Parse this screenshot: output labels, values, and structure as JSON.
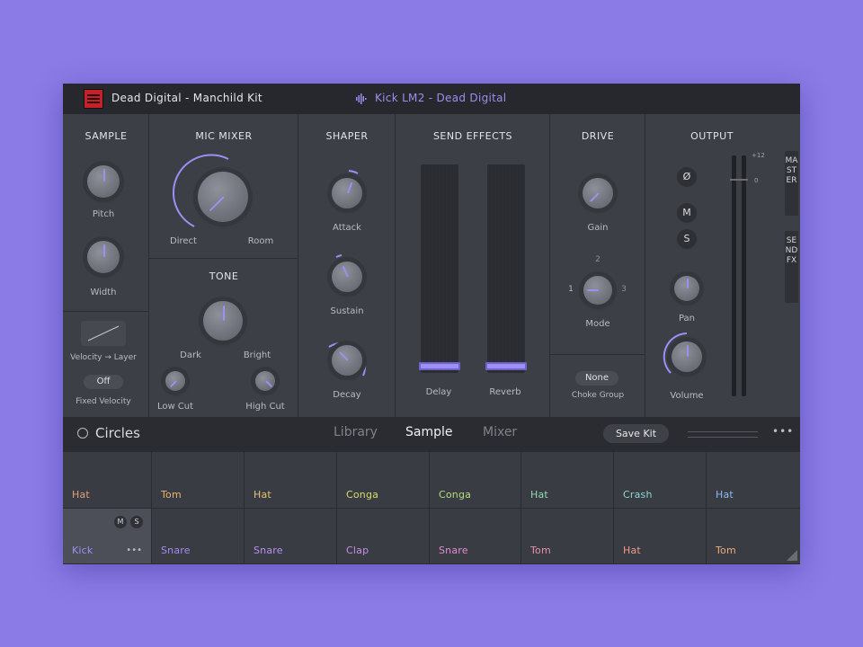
{
  "titlebar": {
    "kit_title": "Dead Digital - Manchild Kit",
    "sample_name": "Kick LM2 - Dead Digital",
    "logo_icon": "dead-digital-logo-icon",
    "wave_icon": "waveform-icon"
  },
  "sample": {
    "title": "SAMPLE",
    "pitch_label": "Pitch",
    "width_label": "Width",
    "velocity_layer_label": "Velocity → Layer",
    "fixed_velocity_value": "Off",
    "fixed_velocity_label": "Fixed Velocity"
  },
  "mic_mixer": {
    "title": "MIC MIXER",
    "direct_label": "Direct",
    "room_label": "Room"
  },
  "tone": {
    "title": "TONE",
    "dark_label": "Dark",
    "bright_label": "Bright",
    "low_cut_label": "Low Cut",
    "high_cut_label": "High Cut"
  },
  "shaper": {
    "title": "SHAPER",
    "attack_label": "Attack",
    "sustain_label": "Sustain",
    "decay_label": "Decay"
  },
  "send_effects": {
    "title": "SEND EFFECTS",
    "delay_label": "Delay",
    "reverb_label": "Reverb"
  },
  "drive": {
    "title": "DRIVE",
    "gain_label": "Gain",
    "mode_label": "Mode",
    "mode_1": "1",
    "mode_2": "2",
    "mode_3": "3",
    "choke_value": "None",
    "choke_label": "Choke Group"
  },
  "output": {
    "title": "OUTPUT",
    "phase_label": "Ø",
    "mute_label": "M",
    "solo_label": "S",
    "pan_label": "Pan",
    "volume_label": "Volume",
    "meter_top": "+12",
    "meter_zero": "0"
  },
  "side_tabs": {
    "master": "MASTER",
    "send_fx": "SEND FX"
  },
  "toolbar": {
    "circles_label": "Circles",
    "tab_library": "Library",
    "tab_sample": "Sample",
    "tab_mixer": "Mixer",
    "save_kit": "Save Kit",
    "more": "•••"
  },
  "pads": {
    "top": [
      {
        "name": "Hat",
        "color": "#e0a07a"
      },
      {
        "name": "Tom",
        "color": "#e7b56c"
      },
      {
        "name": "Hat",
        "color": "#e3c470"
      },
      {
        "name": "Conga",
        "color": "#d8dc6e"
      },
      {
        "name": "Conga",
        "color": "#b6dd7e"
      },
      {
        "name": "Hat",
        "color": "#8fdcb0"
      },
      {
        "name": "Crash",
        "color": "#8fd7d6"
      },
      {
        "name": "Hat",
        "color": "#8db8ef"
      }
    ],
    "bottom": [
      {
        "name": "Kick",
        "color": "#9d8ff5"
      },
      {
        "name": "Snare",
        "color": "#a48cf3"
      },
      {
        "name": "Snare",
        "color": "#b88ff0"
      },
      {
        "name": "Clap",
        "color": "#c58eea"
      },
      {
        "name": "Snare",
        "color": "#e08ed2"
      },
      {
        "name": "Tom",
        "color": "#ea8fa6"
      },
      {
        "name": "Hat",
        "color": "#ee9a8a"
      },
      {
        "name": "Tom",
        "color": "#ecab7a"
      }
    ],
    "selected_mute": "M",
    "selected_solo": "S",
    "selected_more": "•••"
  }
}
